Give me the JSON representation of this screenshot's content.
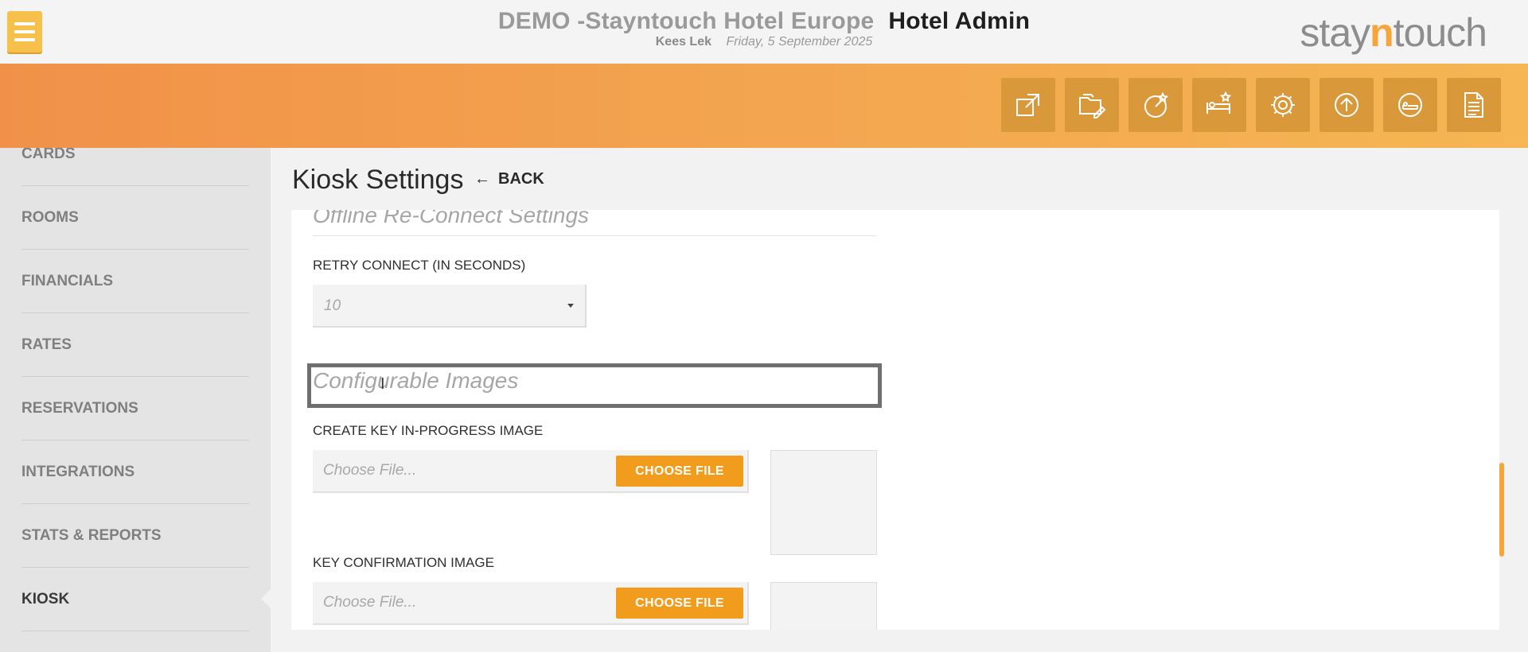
{
  "header": {
    "hotel_name": "DEMO -Stayntouch Hotel Europe",
    "app_name": "Hotel Admin",
    "user": "Kees Lek",
    "date": "Friday, 5 September 2025",
    "logo_left": "stay",
    "logo_mid": "n",
    "logo_right": "touch"
  },
  "toolbar": {
    "icons": [
      "open-external-icon",
      "edit-folder-icon",
      "dashboard-icon",
      "housekeeping-icon",
      "settings-gear-icon",
      "upload-icon",
      "reservation-icon",
      "document-icon"
    ]
  },
  "sidebar": {
    "items": [
      {
        "label": "CARDS"
      },
      {
        "label": "ROOMS"
      },
      {
        "label": "FINANCIALS"
      },
      {
        "label": "RATES"
      },
      {
        "label": "RESERVATIONS"
      },
      {
        "label": "INTEGRATIONS"
      },
      {
        "label": "STATS & REPORTS"
      },
      {
        "label": "KIOSK"
      }
    ],
    "active": "KIOSK"
  },
  "page": {
    "title": "Kiosk Settings",
    "back_label": "BACK"
  },
  "offline": {
    "section_title": "Offline Re-Connect Settings",
    "retry_label": "RETRY CONNECT (IN SECONDS)",
    "retry_value": "10"
  },
  "images": {
    "section_title": "Configurable Images",
    "fields": [
      {
        "label": "CREATE KEY IN-PROGRESS IMAGE",
        "placeholder": "Choose File...",
        "button": "CHOOSE FILE"
      },
      {
        "label": "KEY CONFIRMATION IMAGE",
        "placeholder": "Choose File...",
        "button": "CHOOSE FILE"
      }
    ]
  },
  "colors": {
    "accent": "#f29c1e",
    "band_start": "#f19149",
    "band_end": "#f5b653",
    "tool_bg": "#d9993b"
  }
}
